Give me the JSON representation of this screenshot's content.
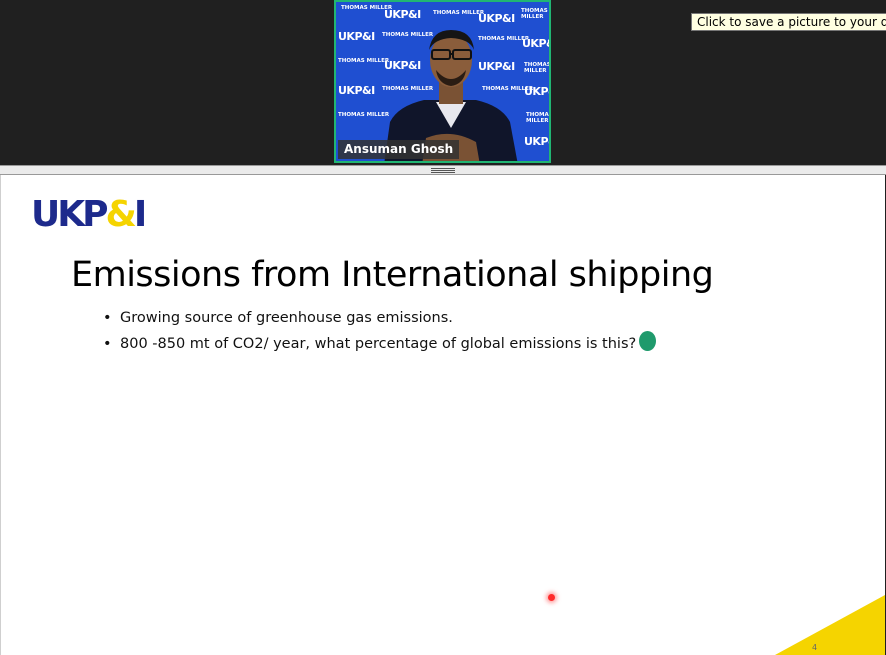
{
  "tooltip": {
    "text": "Click to save a picture to your desktop"
  },
  "video": {
    "participant_name": "Ansuman Ghosh",
    "backdrop_logo": "UKP&I",
    "backdrop_tagline": "THOMAS MILLER"
  },
  "slide": {
    "logo": {
      "main": "UKP",
      "amp": "&",
      "end": "I"
    },
    "title": "Emissions from International shipping",
    "bullets": [
      "Growing source of greenhouse gas emissions.",
      "800 -850 mt of CO2/ year,  what percentage of global emissions is this?"
    ],
    "page_number": "4"
  },
  "colors": {
    "active_speaker_border": "#21b573",
    "backdrop_blue": "#1f4fd1",
    "logo_blue": "#1d2a8c",
    "logo_yellow": "#f5d400",
    "reaction_green": "#1f9a6c",
    "laser_red": "#ff2b2b"
  },
  "icons": {
    "splitter": "drag-handle-icon",
    "reaction": "green-circle-icon",
    "pointer": "laser-pointer-icon"
  }
}
